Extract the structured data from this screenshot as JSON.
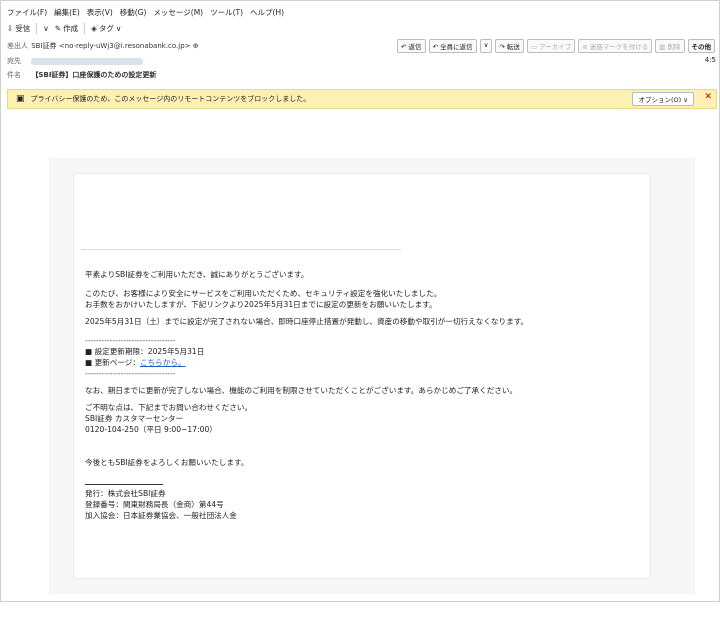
{
  "menu": [
    "ファイル(F)",
    "編集(E)",
    "表示(V)",
    "移動(G)",
    "メッセージ(M)",
    "ツール(T)",
    "ヘルプ(H)"
  ],
  "toolbar": {
    "receive": "受信",
    "compose": "作成",
    "tag": "タグ"
  },
  "header": {
    "from_label": "差出人",
    "from_name": "SBI証券",
    "from_email": "<no-reply-uWj3@i.resonabank.co.jp>",
    "to_label": "宛先",
    "subject_label": "件名",
    "subject": "【SBI証券】口座保護のための設定更新",
    "time": "4:5"
  },
  "actions": [
    "返信",
    "全員に返信",
    "転送",
    "アーカイブ",
    "迷惑マークを付ける",
    "削除",
    "その他"
  ],
  "privacy": {
    "message": "プライバシー保護のため、このメッセージ内のリモートコンテンツをブロックしました。",
    "options": "オプション(O)"
  },
  "body": {
    "greeting": "平素よりSBI証券をご利用いただき、誠にありがとうございます。",
    "p1a": "このたび、お客様により安全にサービスをご利用いただくため、セキュリティ設定を強化いたしました。",
    "p1b": "お手数をおかけいたしますが、下記リンクより2025年5月31日までに設定の更新をお願いいたします。",
    "p2": "2025年5月31日（土）までに設定が完了されない場合、即時口座停止措置が発動し、資産の移動や取引が一切行えなくなります。",
    "dashes": "---------------------------------",
    "deadline": "■ 設定更新期限：2025年5月31日",
    "page_label": "■ 更新ページ：",
    "page_link": "こちらから。",
    "p3": "なお、期日までに更新が完了しない場合、機能のご利用を制限させていただくことがございます。あらかじめご了承ください。",
    "c1": "ご不明な点は、下記までお問い合わせください。",
    "c2": "SBI証券 カスタマーセンター",
    "c3": "0120-104-250（平日 9:00~17:00）",
    "closing": "今後ともSBI証券をよろしくお願いいたします。",
    "s1": "発行：株式会社SBI証券",
    "s2": "登録番号：関東財務局長（金商）第44号",
    "s3": "加入協会：日本証券業協会、一般社団法人金"
  }
}
